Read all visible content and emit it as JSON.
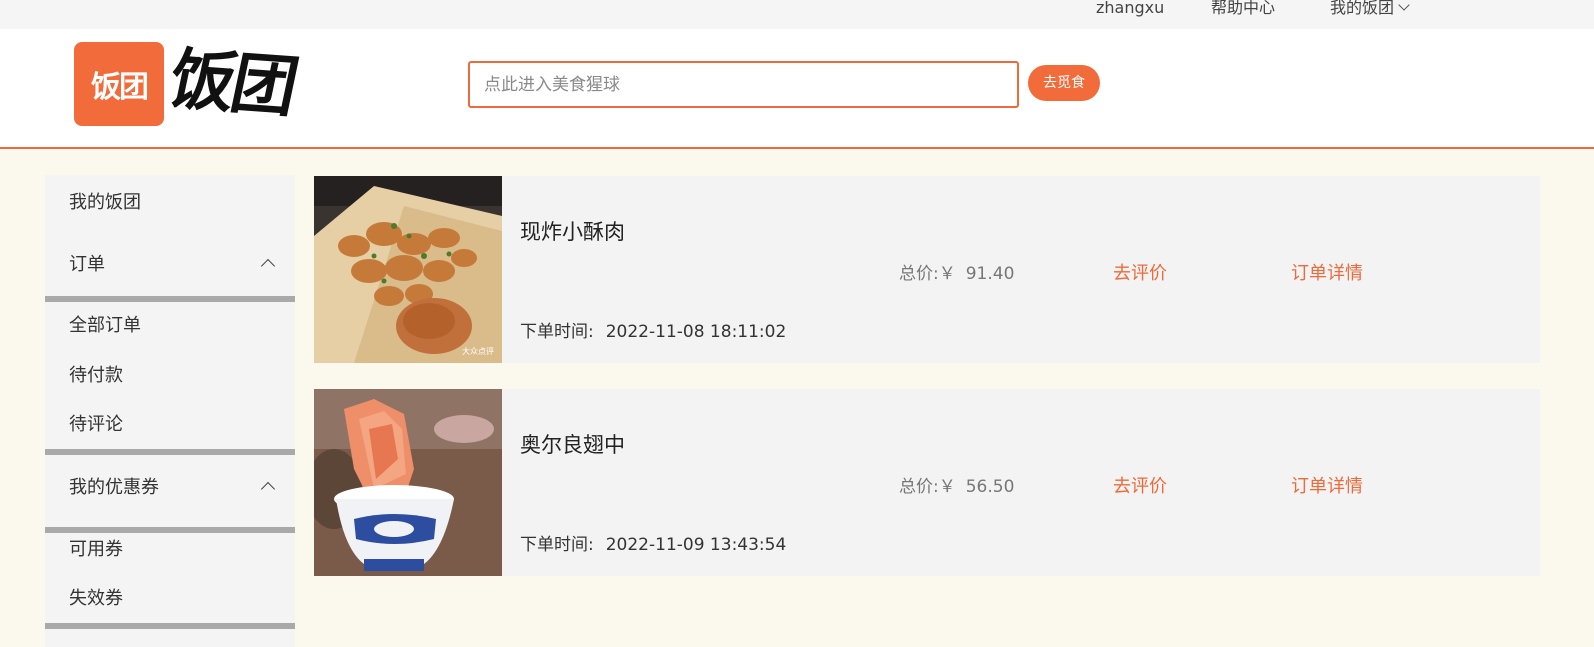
{
  "topbar": {
    "user": "zhangxu",
    "help": "帮助中心",
    "mine": "我的饭团"
  },
  "header": {
    "logo_badge": "饭团",
    "logo_text": "饭团",
    "search_placeholder": "点此进入美食猩球",
    "search_button": "去觅食"
  },
  "sidebar": {
    "my_fantuan": "我的饭团",
    "orders_section": "订单",
    "order_items": [
      "全部订单",
      "待付款",
      "待评论"
    ],
    "coupons_section": "我的优惠券",
    "coupon_items": [
      "可用券",
      "失效券"
    ]
  },
  "orders": [
    {
      "name": "现炸小酥肉",
      "price_label": "总价:￥",
      "price": "91.40",
      "review": "去评价",
      "detail": "订单详情",
      "time_label": "下单时间:",
      "time": "2022-11-08 18:11:02",
      "photo": "fried-pork-photo",
      "watermark": "大众点评"
    },
    {
      "name": "奥尔良翅中",
      "price_label": "总价:￥",
      "price": "56.50",
      "review": "去评价",
      "detail": "订单详情",
      "time_label": "下单时间:",
      "time": "2022-11-09 13:43:54",
      "photo": "chicken-wings-photo"
    }
  ],
  "colors": {
    "accent": "#ee6a3a",
    "page_bg": "#fbf9ee",
    "card_bg": "#f3f3f3",
    "sidebar_bg": "#f4f4f4",
    "divider": "#a9a9a9"
  }
}
